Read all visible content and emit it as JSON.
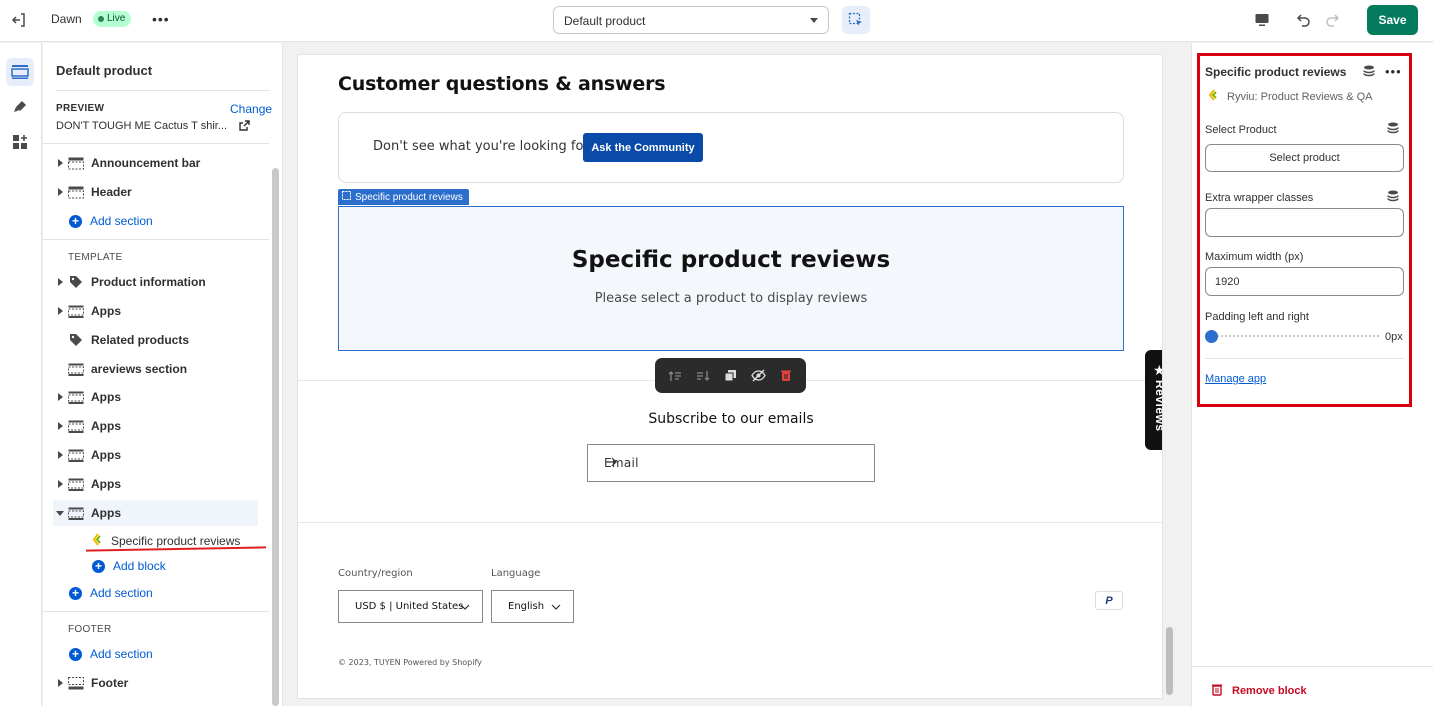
{
  "topbar": {
    "theme_name": "Dawn",
    "live_badge": "Live",
    "template_select": "Default product",
    "save_label": "Save"
  },
  "sidebar": {
    "title": "Default product",
    "preview_label": "PREVIEW",
    "change_link": "Change",
    "preview_value": "DON'T TOUGH ME Cactus T shir...",
    "header_items": [
      {
        "label": "Announcement bar"
      },
      {
        "label": "Header"
      }
    ],
    "add_section": "Add section",
    "template_label": "TEMPLATE",
    "template_items": [
      {
        "label": "Product information"
      },
      {
        "label": "Apps"
      },
      {
        "label": "Related products"
      },
      {
        "label": "areviews section"
      },
      {
        "label": "Apps"
      },
      {
        "label": "Apps"
      },
      {
        "label": "Apps"
      },
      {
        "label": "Apps"
      },
      {
        "label": "Apps"
      }
    ],
    "selected_block": "Specific product reviews",
    "add_block": "Add block",
    "footer_label": "FOOTER",
    "footer_items": [
      {
        "label": "Footer"
      }
    ]
  },
  "preview": {
    "qa_title": "Customer questions & answers",
    "qa_text": "Don't see what you're looking for?",
    "qa_button": "Ask the Community",
    "selected_tag": "Specific product reviews",
    "spr_title": "Specific product reviews",
    "spr_subtitle": "Please select a product to display reviews",
    "subscribe_title": "Subscribe to our emails",
    "email_placeholder": "Email",
    "country_label": "Country/region",
    "country_value": "USD $ | United States",
    "language_label": "Language",
    "language_value": "English",
    "paypal": "P",
    "copyright": "© 2023, TUYEN Powered by Shopify",
    "reviews_tab": "Reviews"
  },
  "panel": {
    "title": "Specific product reviews",
    "app_name": "Ryviu: Product Reviews & QA",
    "select_product_label": "Select Product",
    "select_product_button": "Select product",
    "extra_wrapper_label": "Extra wrapper classes",
    "extra_wrapper_value": "",
    "max_width_label": "Maximum width (px)",
    "max_width_value": "1920",
    "padding_label": "Padding left and right",
    "padding_value": "0px",
    "padding_level": 0,
    "manage_app": "Manage app",
    "remove_block": "Remove block"
  },
  "colors": {
    "accent": "#005bd3",
    "save": "#047b5d",
    "selection": "#2c6ecb",
    "highlight": "#d9000f"
  }
}
